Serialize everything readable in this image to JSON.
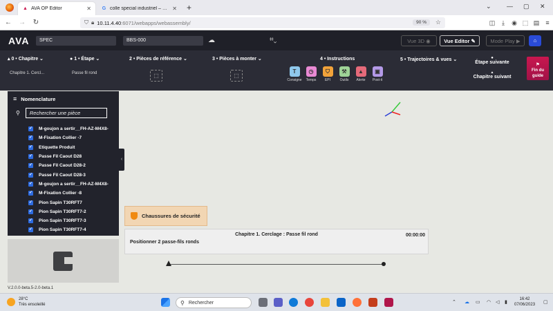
{
  "browser": {
    "tabs": [
      {
        "label": "AVA OP Editor",
        "active": true
      },
      {
        "label": "colle special industriel – Recherche",
        "active": false
      }
    ],
    "url_host": "10.11.4.40",
    "url_rest": ":6071/webapps/webassembly/",
    "zoom": "90 %"
  },
  "app": {
    "logo": "AVA",
    "spec_field": "SPEC",
    "bbs_field": "BBS-000",
    "buttons": {
      "vue3d": "Vue 3D",
      "vue_editor": "Vue Editor",
      "mode_play": "Mode Play"
    }
  },
  "steps": {
    "chapitre": {
      "label": "0 • Chapitre",
      "value": "Chapitre 1. Cercl..."
    },
    "etape": {
      "label": "1 • Étape",
      "value": "Passe fil rond"
    },
    "pieces_ref": "2 • Pièces de référence",
    "pieces_monter": "3 • Pièces à monter",
    "instructions": {
      "title": "4 • Instructions",
      "items": [
        {
          "label": "Consigne",
          "glyph": "T",
          "color": "#8fc8ec"
        },
        {
          "label": "Temps",
          "glyph": "◷",
          "color": "#e98ad4"
        },
        {
          "label": "EPI",
          "glyph": "⛉",
          "color": "#f2a33a"
        },
        {
          "label": "Outils",
          "glyph": "⚒",
          "color": "#9ed397"
        },
        {
          "label": "Alerte",
          "glyph": "▲",
          "color": "#e56a7a"
        },
        {
          "label": "Post-it",
          "glyph": "▣",
          "color": "#b49ae8"
        }
      ]
    },
    "trajectoires": "5 • Trajectoires & vues",
    "next_step": "Étape suivante",
    "next_chapter": "Chapitre suivant",
    "end_guide_1": "Fin du",
    "end_guide_2": "guide"
  },
  "nomenclature": {
    "title": "Nomenclature",
    "search_placeholder": "Rechercher une pièce",
    "parts": [
      "M-goujon a sertir__FH-AZ-M4X8-",
      "M-Fixation Collier -7",
      "Etiquette Produit",
      "Passe Fil Caout D28",
      "Passe Fil Caout D28-2",
      "Passe Fil Caout D28-3",
      "M-goujon a sertir__FH-AZ-M4X8-",
      "M-Fixation Collier -8",
      "Pion Sapin T30RFT7",
      "Pion Sapin T30RFT7-2",
      "Pion Sapin T30RFT7-3",
      "Pion Sapin T30RFT7-4"
    ]
  },
  "version": "V.2.0.0-beta.5-2.0-beta.1",
  "safety_badge": "Chaussures de sécurité",
  "card": {
    "title": "Chapitre 1. Cerclage : Passe fil rond",
    "time": "00:00:00",
    "text": "Positionner 2 passe-fils ronds"
  },
  "taskbar": {
    "temp": "28°C",
    "weather": "Très ensoleillé",
    "search": "Rechercher",
    "time": "16:42",
    "date": "07/06/2023"
  }
}
